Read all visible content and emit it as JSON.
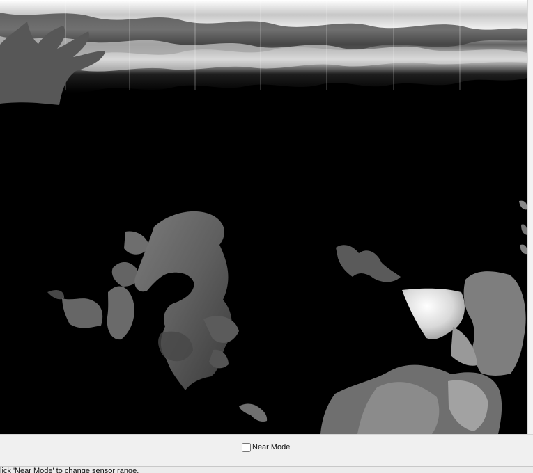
{
  "window": {
    "title": ""
  },
  "controls": {
    "near_mode_label": "Near Mode",
    "near_mode_checked": false
  },
  "status": {
    "text": "lick 'Near Mode' to change sensor range."
  }
}
